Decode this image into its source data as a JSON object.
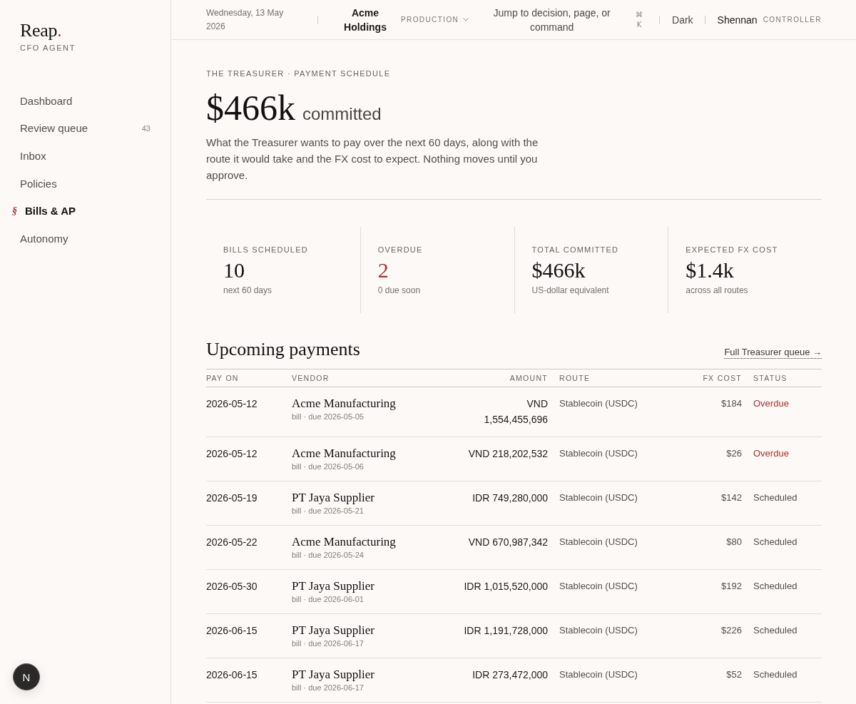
{
  "sidebar": {
    "brand": {
      "name": "Reap",
      "dot": ".",
      "tagline": "CFO AGENT"
    },
    "active_marker": "§",
    "items": [
      {
        "label": "Dashboard",
        "selected": false
      },
      {
        "label": "Review queue",
        "count": "43",
        "selected": false
      },
      {
        "label": "Inbox",
        "selected": false
      },
      {
        "label": "Policies",
        "selected": false
      },
      {
        "label": "Bills & AP",
        "selected": true
      },
      {
        "label": "Autonomy",
        "selected": false
      }
    ]
  },
  "header": {
    "date": "Wednesday, 13 May 2026",
    "organization": "Acme Holdings",
    "environment": "PRODUCTION",
    "search": {
      "placeholder": "Jump to decision, page, or command"
    },
    "shortcut": "⌘ K",
    "theme_toggle": "Dark",
    "user": {
      "name": "Shennan",
      "role": "CONTROLLER"
    }
  },
  "page": {
    "eyebrow": "THE TREASURER · PAYMENT SCHEDULE",
    "headline": "$466k",
    "headline_suffix": "committed",
    "description": "What the Treasurer wants to pay over the next 60 days, along with the route it would take and the FX cost to expect. Nothing moves until you approve."
  },
  "stats": [
    {
      "label": "BILLS SCHEDULED",
      "value": "10",
      "note": "next 60 days",
      "alert": false
    },
    {
      "label": "OVERDUE",
      "value": "2",
      "note": "0 due soon",
      "alert": true
    },
    {
      "label": "TOTAL COMMITTED",
      "value": "$466k",
      "note": "US-dollar equivalent",
      "alert": false
    },
    {
      "label": "EXPECTED FX COST",
      "value": "$1.4k",
      "note": "across all routes",
      "alert": false
    }
  ],
  "payments": {
    "title": "Upcoming payments",
    "link": "Full Treasurer queue →",
    "columns": [
      "PAY ON",
      "VENDOR",
      "AMOUNT",
      "ROUTE",
      "FX COST",
      "STATUS"
    ],
    "rows": [
      {
        "pay_on": "2026-05-12",
        "vendor": "Acme Manufacturing",
        "detail": "bill · due 2026-05-05",
        "amount": "VND 1,554,455,696",
        "route": "Stablecoin (USDC)",
        "fx_cost": "$184",
        "status": "Overdue",
        "overdue": true
      },
      {
        "pay_on": "2026-05-12",
        "vendor": "Acme Manufacturing",
        "detail": "bill · due 2026-05-06",
        "amount": "VND 218,202,532",
        "route": "Stablecoin (USDC)",
        "fx_cost": "$26",
        "status": "Overdue",
        "overdue": true
      },
      {
        "pay_on": "2026-05-19",
        "vendor": "PT Jaya Supplier",
        "detail": "bill · due 2026-05-21",
        "amount": "IDR 749,280,000",
        "route": "Stablecoin (USDC)",
        "fx_cost": "$142",
        "status": "Scheduled",
        "overdue": false
      },
      {
        "pay_on": "2026-05-22",
        "vendor": "Acme Manufacturing",
        "detail": "bill · due 2026-05-24",
        "amount": "VND 670,987,342",
        "route": "Stablecoin (USDC)",
        "fx_cost": "$80",
        "status": "Scheduled",
        "overdue": false
      },
      {
        "pay_on": "2026-05-30",
        "vendor": "PT Jaya Supplier",
        "detail": "bill · due 2026-06-01",
        "amount": "IDR 1,015,520,000",
        "route": "Stablecoin (USDC)",
        "fx_cost": "$192",
        "status": "Scheduled",
        "overdue": false
      },
      {
        "pay_on": "2026-06-15",
        "vendor": "PT Jaya Supplier",
        "detail": "bill · due 2026-06-17",
        "amount": "IDR 1,191,728,000",
        "route": "Stablecoin (USDC)",
        "fx_cost": "$226",
        "status": "Scheduled",
        "overdue": false
      },
      {
        "pay_on": "2026-06-15",
        "vendor": "PT Jaya Supplier",
        "detail": "bill · due 2026-06-17",
        "amount": "IDR 273,472,000",
        "route": "Stablecoin (USDC)",
        "fx_cost": "$52",
        "status": "Scheduled",
        "overdue": false
      }
    ]
  },
  "dev_badge": {
    "label": "N"
  }
}
